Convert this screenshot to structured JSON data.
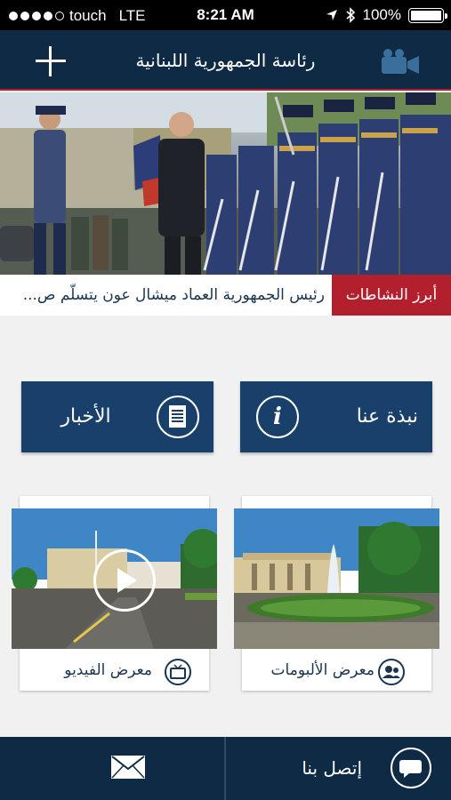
{
  "status_bar": {
    "carrier": "touch",
    "network": "LTE",
    "time": "8:21 AM",
    "battery": "100%",
    "battery_level": 1.0,
    "signal_bars_filled": 4,
    "signal_bars_total": 5
  },
  "header": {
    "title": "رئاسة الجمهورية اللبنانية",
    "add_icon": "plus-icon",
    "video_icon": "video-camera-icon"
  },
  "ticker": {
    "label": "أبرز النشاطات",
    "headline": "رئيس الجمهورية العماد ميشال عون يتسلّم ص..."
  },
  "buttons": {
    "about": "نبذة عنا",
    "news": "الأخبار"
  },
  "gallery": {
    "albums": "معرض الألبومات",
    "videos": "معرض الفيديو"
  },
  "bottom_bar": {
    "contact": "إتصل بنا",
    "mail_icon": "envelope-icon",
    "chat_icon": "chat-bubble-icon"
  },
  "colors": {
    "navy": "#0f2a45",
    "button_blue": "#19406a",
    "accent_red": "#b3202d",
    "background": "#f1f1f2"
  }
}
